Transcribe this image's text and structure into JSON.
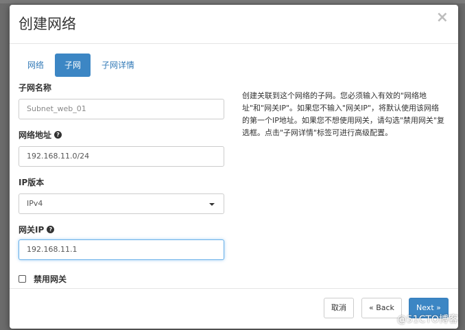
{
  "modal": {
    "title": "创建网络",
    "close": "×"
  },
  "tabs": [
    {
      "label": "网络",
      "active": false
    },
    {
      "label": "子网",
      "active": true
    },
    {
      "label": "子网详情",
      "active": false
    }
  ],
  "form": {
    "subnet_name": {
      "label": "子网名称",
      "placeholder": "Subnet_web_01",
      "value": ""
    },
    "network_address": {
      "label": "网络地址",
      "help": "?",
      "value": "192.168.11.0/24"
    },
    "ip_version": {
      "label": "IP版本",
      "value": "IPv4"
    },
    "gateway_ip": {
      "label": "网关IP",
      "help": "?",
      "value": "192.168.11.1"
    },
    "disable_gateway": {
      "label": "禁用网关",
      "checked": false
    }
  },
  "help_text": "创建关联到这个网络的子网。您必须输入有效的\"网络地址\"和\"网关IP\"。如果您不输入\"网关IP\"，将默认使用该网络的第一个IP地址。如果您不想使用网关，请勾选\"禁用网关\"复选框。点击\"子网详情\"标签可进行高级配置。",
  "footer": {
    "cancel_label": "取消",
    "back_label": "« Back",
    "next_label": "Next »"
  },
  "watermark": "@51CTO博客",
  "colors": {
    "primary": "#3c86c4",
    "link": "#337ab7",
    "focus_border": "#66afe9"
  }
}
